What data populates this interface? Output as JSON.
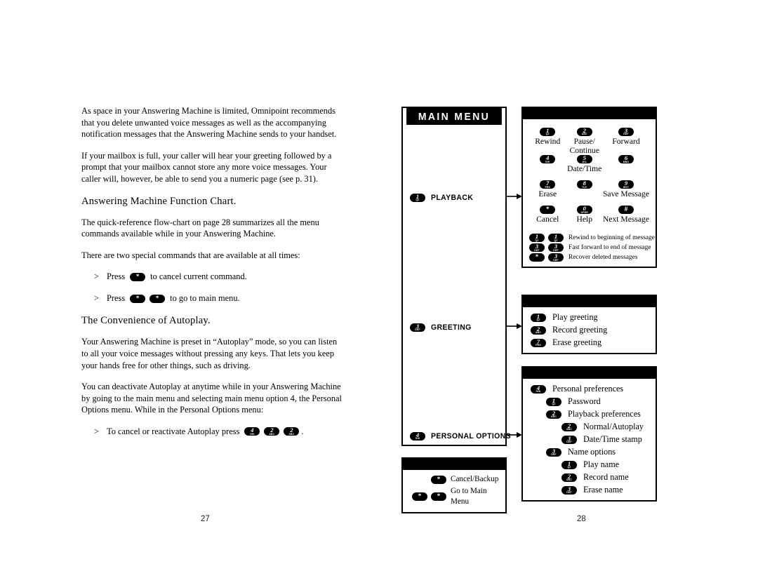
{
  "left_column": {
    "paragraphs": [
      "As space in your Answering Machine is limited, Omnipoint recommends that you delete unwanted voice messages as well as the accompanying notification messages that the Answering Machine sends to your handset.",
      "If your mailbox is full, your caller will hear your greeting followed by a prompt that your mailbox cannot store any more voice messages. Your caller will, however, be able to send you a numeric page (see p. 31)."
    ],
    "heading_1": "Answering Machine Function Chart.",
    "paragraphs_2": [
      "The quick-reference flow-chart on page 28 summarizes all the menu commands available while in your Answering Machine.",
      "There are two special commands that are available at all times:"
    ],
    "bullet_1": {
      "marker": ">",
      "before": "Press",
      "after": "to cancel current command.",
      "keys": [
        "*"
      ]
    },
    "bullet_2": {
      "marker": ">",
      "before": "Press",
      "after": "to go to main menu.",
      "keys": [
        "*",
        "*"
      ]
    },
    "heading_2": "The Convenience of Autoplay.",
    "paragraphs_3": [
      "Your Answering Machine is preset in “Autoplay” mode, so you can listen to all your voice messages without pressing any keys.  That lets you keep your hands free for other things, such as driving.",
      "You can deactivate Autoplay at anytime while in your Answering Machine by going to the main menu and selecting main menu option 4, the Personal Options menu.  While in the Personal Options menu:"
    ],
    "bullet_3": {
      "marker": ">",
      "before": "To cancel or reactivate Autoplay press",
      "after": ".",
      "keys": [
        "4",
        "2",
        "2"
      ]
    }
  },
  "folios": {
    "left": "27",
    "right": "28"
  },
  "flowchart": {
    "main_menu": {
      "title": "MAIN MENU",
      "items": [
        {
          "key": "1",
          "label": "PLAYBACK"
        },
        {
          "key": "3",
          "label": "GREETING"
        },
        {
          "key": "4",
          "label": "PERSONAL OPTIONS"
        }
      ]
    },
    "legend": {
      "rows": [
        {
          "keys": [
            "*"
          ],
          "text": "Cancel/Backup"
        },
        {
          "keys": [
            "*",
            "*"
          ],
          "text": "Go to Main Menu"
        }
      ]
    },
    "playback_submenu": {
      "keypad": [
        {
          "key": "1",
          "caption": "Rewind"
        },
        {
          "key": "2",
          "caption": "Pause/\nContinue"
        },
        {
          "key": "3",
          "caption": "Forward"
        },
        {
          "key": "4",
          "caption": ""
        },
        {
          "key": "5",
          "caption": "Date/Time"
        },
        {
          "key": "6",
          "caption": ""
        },
        {
          "key": "7",
          "caption": "Erase"
        },
        {
          "key": "8",
          "caption": ""
        },
        {
          "key": "9",
          "caption": "Save Message"
        },
        {
          "key": "*",
          "caption": "Cancel"
        },
        {
          "key": "0",
          "caption": "Help"
        },
        {
          "key": "#",
          "caption": "Next Message"
        }
      ],
      "combos": [
        {
          "keys": [
            "1",
            "1"
          ],
          "text": "Rewind to beginning of message"
        },
        {
          "keys": [
            "3",
            "3"
          ],
          "text": "Fast forward to end of message"
        },
        {
          "keys": [
            "*",
            "3"
          ],
          "text": "Recover deleted messages"
        }
      ]
    },
    "greeting_submenu": {
      "options": [
        {
          "key": "1",
          "label": "Play greeting",
          "indent": 0
        },
        {
          "key": "2",
          "label": "Record greeting",
          "indent": 0
        },
        {
          "key": "7",
          "label": "Erase greeting",
          "indent": 0
        }
      ]
    },
    "personal_submenu": {
      "options": [
        {
          "key": "4",
          "label": "Personal preferences",
          "indent": 0
        },
        {
          "key": "1",
          "label": "Password",
          "indent": 1
        },
        {
          "key": "2",
          "label": "Playback preferences",
          "indent": 1
        },
        {
          "key": "2",
          "label": "Normal/Autoplay",
          "indent": 2
        },
        {
          "key": "3",
          "label": "Date/Time stamp",
          "indent": 2
        },
        {
          "key": "3",
          "label": "Name options",
          "indent": 1
        },
        {
          "key": "1",
          "label": "Play name",
          "indent": 2
        },
        {
          "key": "2",
          "label": "Record name",
          "indent": 2
        },
        {
          "key": "3",
          "label": "Erase name",
          "indent": 2
        }
      ]
    }
  },
  "key_sublabels": {
    "1": "QZ",
    "2": "ABC",
    "3": "DEF",
    "4": "GHI",
    "5": "JKL",
    "6": "MNO",
    "7": "PRS",
    "8": "TUV",
    "9": "WXY",
    "0": "OPER",
    "*": "",
    "#": ""
  },
  "colors": {
    "ink": "#000000",
    "paper": "#ffffff"
  }
}
